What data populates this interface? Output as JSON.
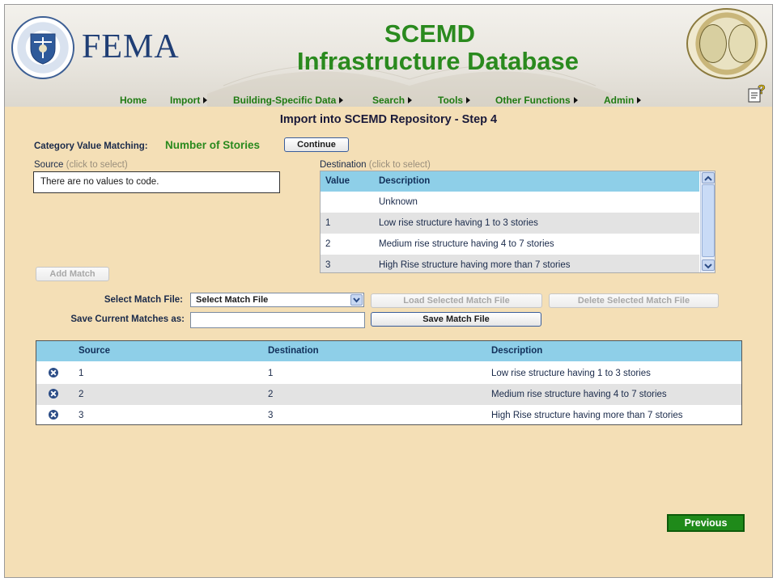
{
  "header": {
    "fema_text": "FEMA",
    "title_line1": "SCEMD",
    "title_line2": "Infrastructure Database",
    "dhs_seal_icon": "dhs-seal-logo",
    "sc_seal_icon": "south-carolina-seal-logo",
    "help_icon": "help-question-icon"
  },
  "nav": {
    "items": [
      {
        "label": "Home",
        "has_arrow": false
      },
      {
        "label": "Import",
        "has_arrow": true
      },
      {
        "label": "Building-Specific Data",
        "has_arrow": true
      },
      {
        "label": "Search",
        "has_arrow": true
      },
      {
        "label": "Tools",
        "has_arrow": true
      },
      {
        "label": "Other Functions",
        "has_arrow": true
      },
      {
        "label": "Admin",
        "has_arrow": true
      }
    ]
  },
  "page_title": "Import into SCEMD Repository - Step 4",
  "category": {
    "label": "Category Value Matching:",
    "value": "Number of Stories",
    "continue_label": "Continue"
  },
  "source": {
    "label": "Source",
    "hint": "(click to select)",
    "empty_text": "There are no values to code."
  },
  "destination": {
    "label": "Destination",
    "hint": "(click to select)",
    "columns": [
      "Value",
      "Description"
    ],
    "rows": [
      {
        "value": "",
        "description": "Unknown"
      },
      {
        "value": "1",
        "description": "Low rise structure having 1 to 3 stories"
      },
      {
        "value": "2",
        "description": "Medium rise structure having 4 to 7 stories"
      },
      {
        "value": "3",
        "description": "High Rise structure having more than 7 stories"
      }
    ]
  },
  "add_match_label": "Add Match",
  "match_file": {
    "select_label": "Select Match File:",
    "select_value": "Select Match File",
    "load_label": "Load Selected Match File",
    "delete_label": "Delete Selected Match File",
    "save_as_label": "Save Current Matches as:",
    "save_as_value": "",
    "save_label": "Save Match File"
  },
  "matches": {
    "columns": [
      "Source",
      "Destination",
      "Description"
    ],
    "rows": [
      {
        "source": "1",
        "destination": "1",
        "description": "Low rise structure having 1 to 3 stories"
      },
      {
        "source": "2",
        "destination": "2",
        "description": "Medium rise structure having 4 to 7 stories"
      },
      {
        "source": "3",
        "destination": "3",
        "description": "High Rise structure having more than 7 stories"
      }
    ]
  },
  "previous_label": "Previous",
  "colors": {
    "page_bg": "#f4dfb6",
    "title_green": "#2a8a1e",
    "table_header": "#8ecfe8",
    "previous_bg": "#1f8a1a"
  }
}
